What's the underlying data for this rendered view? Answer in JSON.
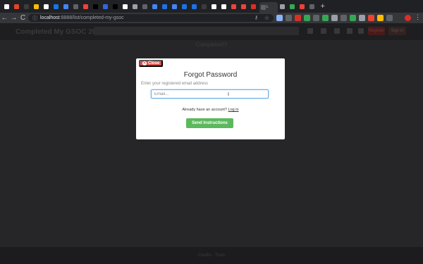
{
  "browser": {
    "tab_label_active": "L",
    "url_host": "localhost",
    "url_path": ":8888/list/completed-my-gsoc",
    "new_tab": "+",
    "back": "←",
    "forward": "→",
    "reload": "C",
    "star": "☆",
    "key": "⚷",
    "menu": "⋮"
  },
  "app": {
    "brand": "Completed My GSOC 2019",
    "register_label": "Register",
    "signin_label": "Sign in",
    "page_heading": "Completed!!!",
    "footer_text": "Credits · Tools"
  },
  "modal": {
    "close_label": "Close",
    "title": "Forgot Password",
    "email_label": "Enter your registered email address",
    "email_placeholder": "Email...",
    "login_prompt": "Already have an account?",
    "login_link": "Log in",
    "submit_label": "Send Instructions"
  },
  "colors": {
    "close_red": "#d9534f",
    "submit_green": "#5cb85c",
    "input_focus": "#66afe9"
  }
}
